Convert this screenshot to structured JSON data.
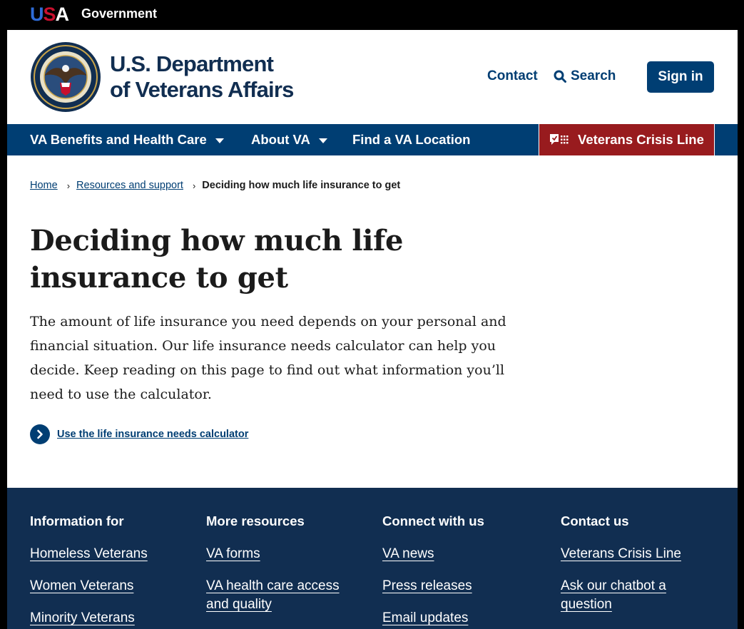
{
  "gov_banner": {
    "logo_us": "US",
    "logo_a": "A",
    "label": "Government"
  },
  "header": {
    "title_line1": "U.S. Department",
    "title_line2": "of Veterans Affairs",
    "contact": "Contact",
    "search": "Search",
    "sign_in": "Sign in"
  },
  "nav": {
    "items": [
      {
        "label": "VA Benefits and Health Care",
        "has_dropdown": true
      },
      {
        "label": "About VA",
        "has_dropdown": true
      },
      {
        "label": "Find a VA Location",
        "has_dropdown": false
      }
    ],
    "crisis_line": "Veterans Crisis Line"
  },
  "breadcrumb": {
    "items": [
      "Home",
      "Resources and support"
    ],
    "current": "Deciding how much life insurance to get"
  },
  "main": {
    "title": "Deciding how much life insurance to get",
    "intro": "The amount of life insurance you need depends on your personal and financial situation. Our life insurance needs calculator can help you decide. Keep reading on this page to find out what information you’ll need to use the calculator.",
    "action_link": "Use the life insurance needs calculator"
  },
  "footer": {
    "columns": [
      {
        "heading": "Information for",
        "links": [
          "Homeless Veterans",
          "Women Veterans",
          "Minority Veterans"
        ]
      },
      {
        "heading": "More resources",
        "links": [
          "VA forms",
          "VA health care access and quality"
        ]
      },
      {
        "heading": "Connect with us",
        "links": [
          "VA news",
          "Press releases",
          "Email updates"
        ]
      },
      {
        "heading": "Contact us",
        "links": [
          "Veterans Crisis Line",
          "Ask our chatbot a question"
        ]
      }
    ]
  },
  "colors": {
    "primary": "#003e73",
    "dark_blue": "#112e51",
    "crisis_red": "#981b1e",
    "usa_blue": "#2e6bd6",
    "usa_red": "#c8102e"
  },
  "icons": [
    "search-icon",
    "chat-icon",
    "chevron-right-icon",
    "va-seal-icon",
    "caret-down-icon"
  ]
}
